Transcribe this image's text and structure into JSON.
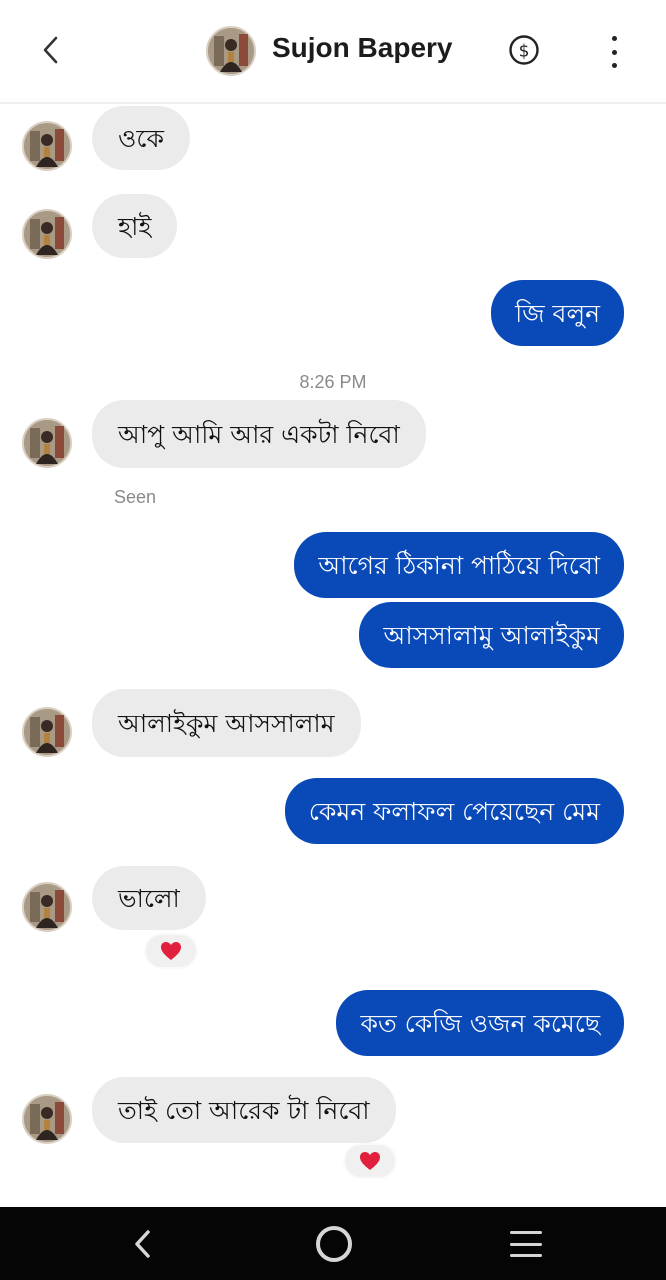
{
  "header": {
    "contact_name": "Sujon Bapery",
    "back_icon": "chevron-left-icon",
    "payment_icon": "dollar-circle-icon",
    "more_icon": "more-vertical-icon"
  },
  "messages": {
    "m1": "ওকে",
    "m2": "হাই",
    "m3": "জি বলুন",
    "m4": "আপু আমি আর একটা নিবো",
    "m5": "আগের ঠিকানা পাঠিয়ে দিবো",
    "m6": "আসসালামু আলাইকুম",
    "m7": "আলাইকুম আসসালাম",
    "m8": "কেমন ফলাফল পেয়েছেন মেম",
    "m9": "ভালো",
    "m10": "কত কেজি ওজন কমেছে",
    "m11": "তাই তো আরেক টা নিবো"
  },
  "timestamp": "8:26 PM",
  "seen_label": "Seen",
  "reactions": {
    "r1": "heart",
    "r2": "heart"
  },
  "colors": {
    "outgoing_bubble": "#0a4ab8",
    "incoming_bubble": "#ebebeb",
    "reaction_heart": "#e0203c",
    "navbar": "#050505"
  },
  "system_nav": {
    "back_icon": "nav-back-icon",
    "home_icon": "nav-home-icon",
    "recents_icon": "nav-recents-icon"
  }
}
